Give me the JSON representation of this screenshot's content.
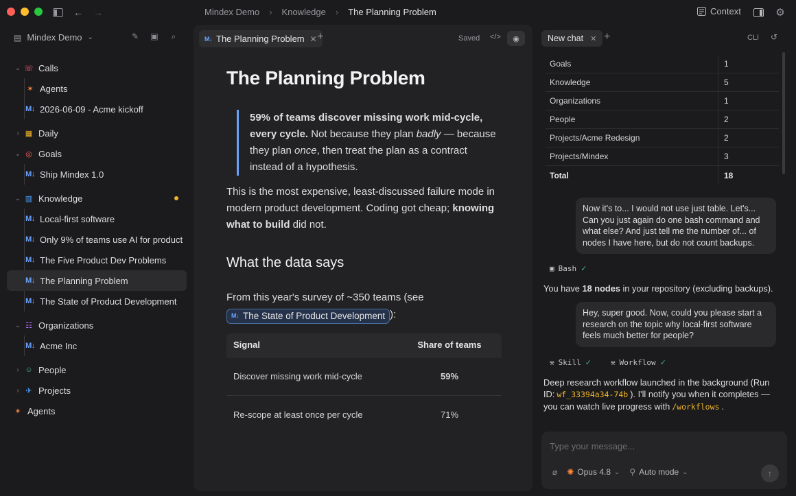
{
  "titlebar": {
    "breadcrumbs": [
      "Mindex Demo",
      "Knowledge",
      "The Planning Problem"
    ],
    "context_label": "Context"
  },
  "sidebar": {
    "workspace": "Mindex Demo",
    "items": [
      {
        "label": "Calls"
      },
      {
        "label": "Agents"
      },
      {
        "label": "2026-06-09 - Acme kickoff"
      },
      {
        "label": "Daily"
      },
      {
        "label": "Goals"
      },
      {
        "label": "Ship Mindex 1.0"
      },
      {
        "label": "Knowledge"
      },
      {
        "label": "Local-first software"
      },
      {
        "label": "Only 9% of teams use AI for product"
      },
      {
        "label": "The Five Product Dev Problems"
      },
      {
        "label": "The Planning Problem"
      },
      {
        "label": "The State of Product Development"
      },
      {
        "label": "Organizations"
      },
      {
        "label": "Acme Inc"
      },
      {
        "label": "People"
      },
      {
        "label": "Projects"
      },
      {
        "label": "Agents"
      }
    ]
  },
  "editor": {
    "tab_label": "The Planning Problem",
    "saved_label": "Saved",
    "title": "The Planning Problem",
    "quote": {
      "bold": "59% of teams discover missing work mid-cycle, every cycle.",
      "t1": " Not because they plan ",
      "em1": "badly",
      "t2": " — because they plan ",
      "em2": "once",
      "t3": ", then treat the plan as a contract instead of a hypothesis."
    },
    "para": {
      "t1": "This is the most expensive, least-discussed failure mode in modern product development. Coding got cheap; ",
      "bold": "knowing what to build",
      "t2": " did not."
    },
    "h2": "What the data says",
    "survey_text": "From this year's survey of ~350 teams (see",
    "survey_link": "The State of Product Development",
    "survey_end": "):",
    "table": {
      "headers": [
        "Signal",
        "Share of teams"
      ],
      "rows": [
        [
          "Discover missing work mid-cycle",
          "59%"
        ],
        [
          "Re-scope at least once per cycle",
          "71%"
        ]
      ]
    }
  },
  "chat": {
    "tab_label": "New chat",
    "cli_label": "CLI",
    "table": [
      [
        "Goals",
        "1"
      ],
      [
        "Knowledge",
        "5"
      ],
      [
        "Organizations",
        "1"
      ],
      [
        "People",
        "2"
      ],
      [
        "Projects/Acme Redesign",
        "2"
      ],
      [
        "Projects/Mindex",
        "3"
      ],
      [
        "Total",
        "18"
      ]
    ],
    "user_msg_1": "Now it's to... I would not use just table. Let's... Can you just again do one bash command and what else? And just tell me the number of... of nodes I have here, but do not count backups.",
    "tool_bash": "Bash",
    "reply_1": {
      "t1": "You have ",
      "bold": "18 nodes",
      "t2": " in your repository (excluding backups)."
    },
    "user_msg_2": "Hey, super good. Now, could you please start a research on the topic why local-first software feels much better for people?",
    "tool_skill": "Skill",
    "tool_workflow": "Workflow",
    "reply_2": {
      "t1": "Deep research workflow launched in the background (Run ID:",
      "code1": "wf_33394a34-74b",
      "t2": "). I'll notify you when it completes — you can watch live progress with",
      "code2": "/workflows",
      "t3": "."
    },
    "composer": {
      "placeholder": "Type your message...",
      "model": "Opus 4.8",
      "mode": "Auto mode"
    }
  }
}
